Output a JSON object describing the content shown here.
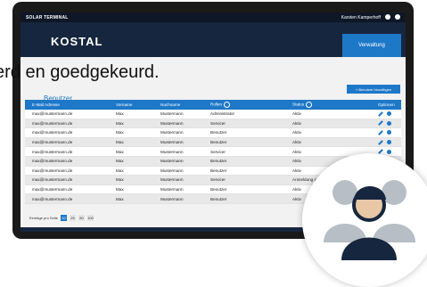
{
  "app": {
    "title": "SOLAR TERMINAL",
    "user": "Karsten Kamperhoff",
    "logo": "KOSTAL",
    "nav_button": "Verwaltung"
  },
  "caption": "erd en goedgekeurd.",
  "page": {
    "title": "Benutzer",
    "add_button": "+   Benutzer hinzufügen"
  },
  "table": {
    "headers": [
      "E-Mail Adresse",
      "Vorname",
      "Nachname",
      "Rollen",
      "Status",
      "Optionen"
    ],
    "rows": [
      [
        "max@mustermann.de",
        "Max",
        "Mustermann",
        "Administrator",
        "Aktiv"
      ],
      [
        "max@mustermann.de",
        "Max",
        "Mustermann",
        "Servicer",
        "Aktiv"
      ],
      [
        "max@mustermann.de",
        "Max",
        "Mustermann",
        "Benutzer",
        "Aktiv"
      ],
      [
        "max@mustermann.de",
        "Max",
        "Mustermann",
        "Benutzer",
        "Aktiv"
      ],
      [
        "max@mustermann.de",
        "Max",
        "Mustermann",
        "Servicer",
        "Aktiv"
      ],
      [
        "max@mustermann.de",
        "Max",
        "Mustermann",
        "Benutzer",
        "Aktiv"
      ],
      [
        "max@mustermann.de",
        "Max",
        "Mustermann",
        "Benutzer",
        "Aktiv"
      ],
      [
        "max@mustermann.de",
        "Max",
        "Mustermann",
        "Servicer",
        "Anmeldung abgelaufen"
      ],
      [
        "max@mustermann.de",
        "Max",
        "Mustermann",
        "Benutzer",
        "Aktiv"
      ],
      [
        "max@mustermann.de",
        "Max",
        "Mustermann",
        "Benutzer",
        "Aktiv"
      ]
    ]
  },
  "pagination": {
    "label": "Einträge pro Seite",
    "options": [
      "10",
      "25",
      "50",
      "100"
    ],
    "active": "10"
  },
  "colors": {
    "accent": "#1e78c8",
    "navy": "#16263e"
  },
  "icons": {
    "edit": "pencil-icon",
    "settings": "gear-icon",
    "info": "info-icon",
    "users": "user-group-icon"
  }
}
